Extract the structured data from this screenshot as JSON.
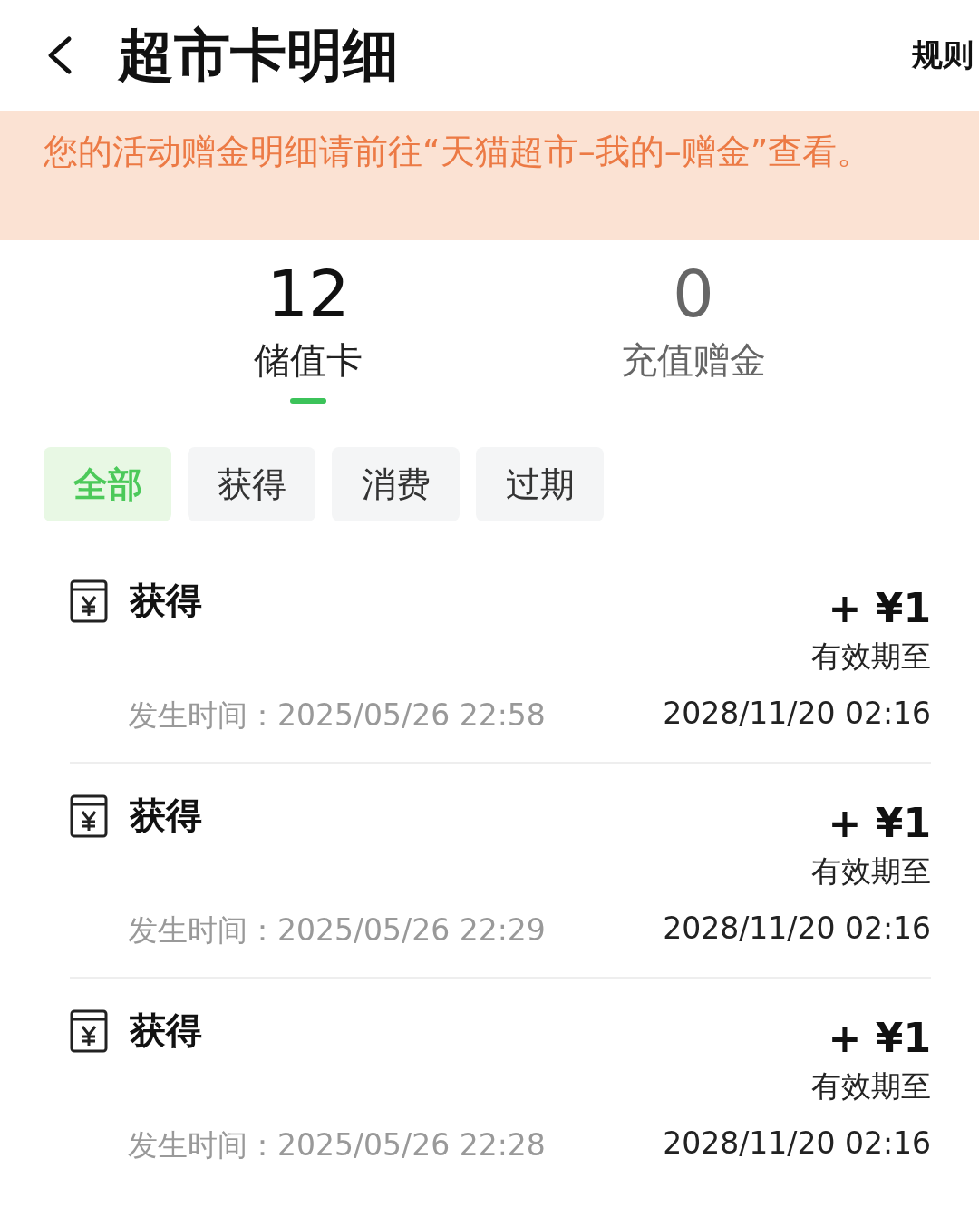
{
  "header": {
    "title": "超市卡明细",
    "rules_link": "规则"
  },
  "notice": "您的活动赠金明细请前往“天猫超市–我的–赠金”查看。",
  "summary_tabs": [
    {
      "value": "12",
      "label": "储值卡",
      "selected": true
    },
    {
      "value": "0",
      "label": "充值赠金",
      "selected": false
    }
  ],
  "filters": [
    {
      "label": "全部",
      "selected": true
    },
    {
      "label": "获得",
      "selected": false
    },
    {
      "label": "消费",
      "selected": false
    },
    {
      "label": "过期",
      "selected": false
    }
  ],
  "records": [
    {
      "type": "获得",
      "amount": "+ ¥1",
      "expiry_label": "有效期至",
      "time": "发生时间：2025/05/26 22:58",
      "expiry": "2028/11/20 02:16"
    },
    {
      "type": "获得",
      "amount": "+ ¥1",
      "expiry_label": "有效期至",
      "time": "发生时间：2025/05/26 22:29",
      "expiry": "2028/11/20 02:16"
    },
    {
      "type": "获得",
      "amount": "+ ¥1",
      "expiry_label": "有效期至",
      "time": "发生时间：2025/05/26 22:28",
      "expiry": "2028/11/20 02:16"
    }
  ]
}
